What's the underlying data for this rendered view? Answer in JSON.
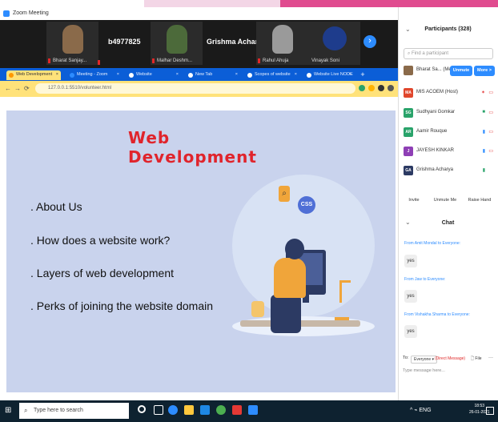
{
  "zoom": {
    "window_title": "Zoom Meeting",
    "window_controls": [
      "–",
      "☐",
      "✕"
    ]
  },
  "video_strip": {
    "tiles": [
      {
        "name": "Bharat Sanjay..."
      },
      {
        "name": ""
      },
      {
        "name": "Malhar Deshm..."
      },
      {
        "name": "Rahul Ahuja"
      },
      {
        "name": "Vinayak Soni"
      }
    ],
    "big_names": [
      "b4977825",
      "Grishma Acharya"
    ],
    "next_icon": "chevron-right-icon"
  },
  "browser": {
    "tabs": [
      {
        "label": "Web Development",
        "active": true
      },
      {
        "label": "Meeting - Zoom",
        "active": false
      },
      {
        "label": "Website",
        "active": false
      },
      {
        "label": "New Tab",
        "active": false
      },
      {
        "label": "Scopes of website",
        "active": false
      },
      {
        "label": "Website Live NODE",
        "active": false
      }
    ],
    "url": "127.0.0.1:5510/volunteer.html"
  },
  "slide": {
    "title": "Web Development",
    "bullets": [
      ". About Us",
      ". How does a website work?",
      ". Layers of web development",
      ". Perks of joining the website domain"
    ],
    "illustration_badge": "CSS"
  },
  "participants": {
    "title": "Participants (328)",
    "search_placeholder": "Find a participant",
    "host_row": {
      "name": "Bharat Sa... (Me)",
      "unmute_label": "Unmute",
      "more_label": "More >"
    },
    "rows": [
      {
        "initials": "MA",
        "name": "MIS ACOEM (Host)",
        "color": "#e0462c"
      },
      {
        "initials": "SG",
        "name": "Sudhyani Gomkar",
        "color": "#29a36a"
      },
      {
        "initials": "AR",
        "name": "Aamir Rouque",
        "color": "#29a36a"
      },
      {
        "initials": "J",
        "name": "JAYESH KINKAR",
        "color": "#8e3fb5"
      },
      {
        "initials": "GA",
        "name": "Grishma Acharya",
        "color": "#2c3a63"
      }
    ],
    "buttons": [
      "Invite",
      "Unmute Me",
      "Raise Hand"
    ]
  },
  "chat": {
    "title": "Chat",
    "messages": [
      {
        "from": "From Amit Mondal to Everyone:",
        "text": "yes"
      },
      {
        "from": "From Jaw to Everyone:",
        "text": "yes"
      },
      {
        "from": "From Vishakha Sharma to Everyone:",
        "text": "yes"
      }
    ],
    "to_label": "To:",
    "to_select": "Everyone ▾",
    "direct_message": "(Direct Message)",
    "file_label": "File",
    "more_label": "···",
    "input_placeholder": "Type message here..."
  },
  "taskbar": {
    "search_placeholder": "Type here to search",
    "tray_text": "^ ⌁ ENG",
    "time": "18:53",
    "date": "26-01-2021"
  }
}
